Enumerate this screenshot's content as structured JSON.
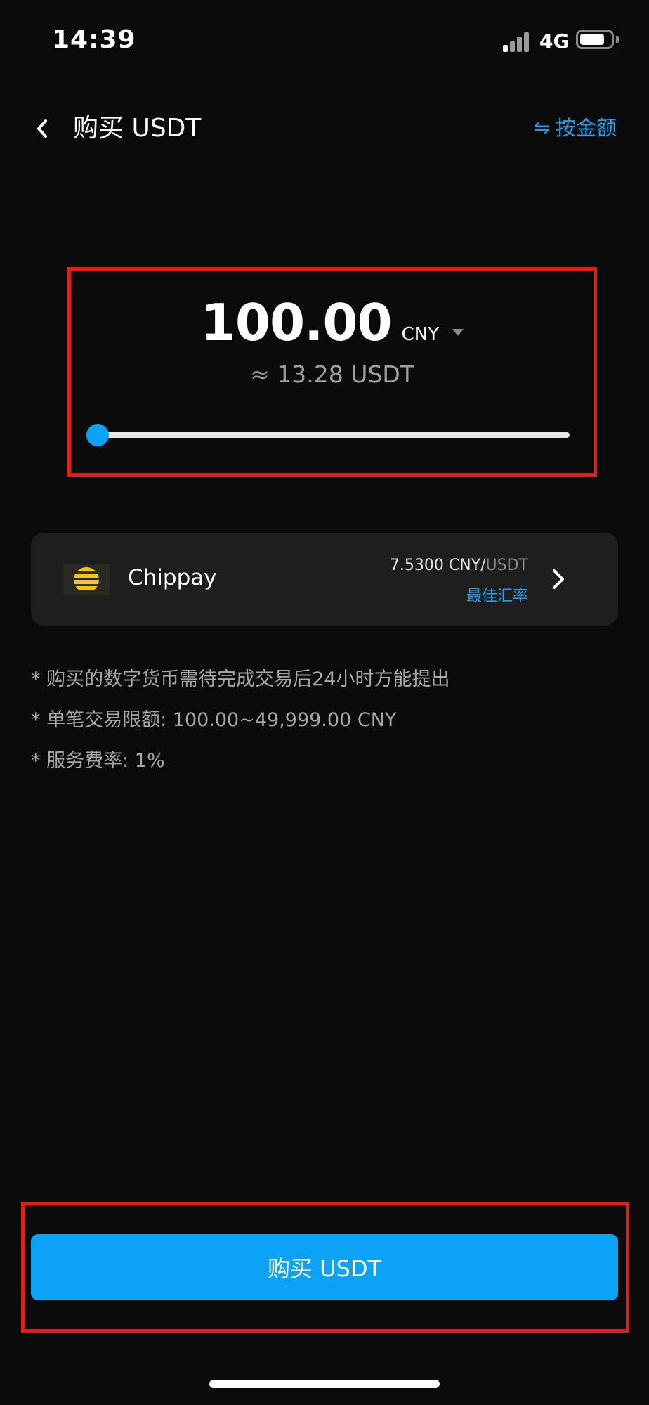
{
  "status_bar": {
    "time": "14:39",
    "network": "4G",
    "battery_level": 0.8
  },
  "nav": {
    "title": "购买 USDT",
    "switch_label": "按金额",
    "switch_icon": "swap-arrows-icon",
    "back_icon": "chevron-left-icon"
  },
  "amount": {
    "value": "100.00",
    "currency": "CNY",
    "converted": "≈ 13.28 USDT",
    "slider_fraction": 0.0
  },
  "provider": {
    "name": "Chippay",
    "rate_value": "7.5300 CNY/",
    "rate_unit": "USDT",
    "badge": "最佳汇率",
    "logo_color": "#f3c51a"
  },
  "notes": [
    "* 购买的数字货币需待完成交易后24小时方能提出",
    "* 单笔交易限额: 100.00~49,999.00 CNY",
    "* 服务费率: 1%"
  ],
  "actions": {
    "buy_label": "购买 USDT"
  },
  "colors": {
    "accent": "#0aa3f5",
    "link": "#1da1f2",
    "highlight_border": "#e41e12",
    "background": "#0b0b0b"
  }
}
